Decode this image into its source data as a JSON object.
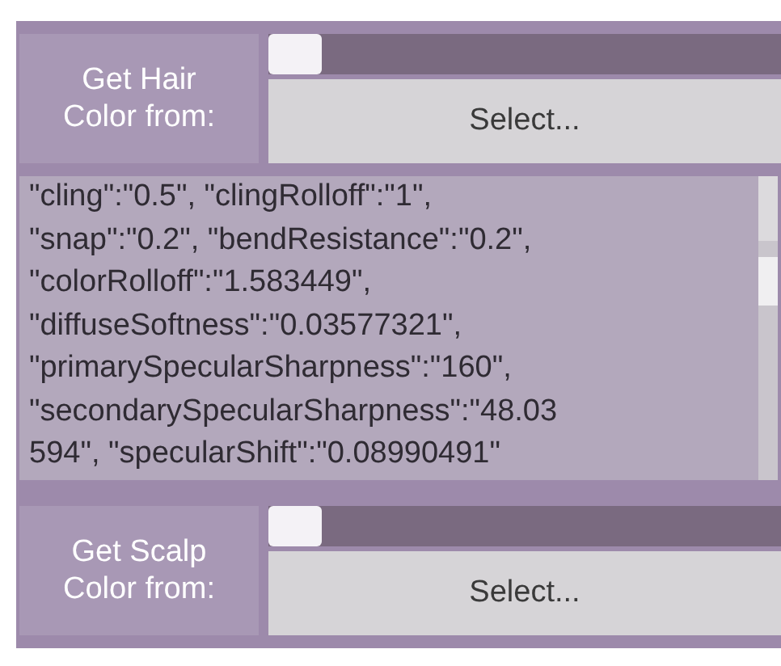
{
  "hair_color": {
    "label": "Get Hair Color from:",
    "level": 0,
    "button": "Select..."
  },
  "json_text": {
    "lines": [
      "\"cling\":\"0.5\", \"clingRolloff\":\"1\",",
      "\"snap\":\"0.2\", \"bendResistance\":\"0.2\",",
      "\"colorRolloff\":\"1.583449\",",
      "\"diffuseSoftness\":\"0.03577321\",",
      "\"primarySpecularSharpness\":\"160\",",
      "\"secondarySpecularSharpness\":\"48.03",
      "594\", \"specularShift\":\"0.08990491\""
    ]
  },
  "scalp_color": {
    "label": "Get Scalp Color from:",
    "level": 0,
    "button": "Select..."
  }
}
